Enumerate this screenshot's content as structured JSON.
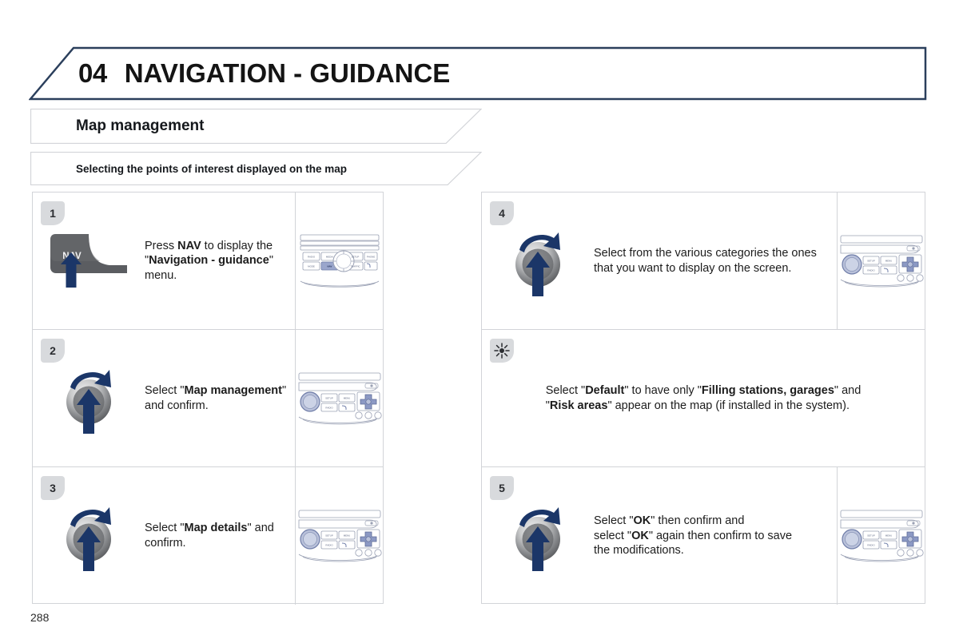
{
  "page": {
    "number": "288",
    "accent_color": "#2b3f5c",
    "badge_color": "#d8dadd",
    "border_color": "#d2d4d8",
    "arrow_color": "#1b3668"
  },
  "header": {
    "chapter_number": "04",
    "chapter_title": "NAVIGATION - GUIDANCE"
  },
  "sections": {
    "main_title": "Map management",
    "sub_title": "Selecting the points of interest displayed on the map"
  },
  "left_column": {
    "steps": [
      {
        "badge": "1",
        "control_icon": "nav-button-icon",
        "control_label": "NAV",
        "text_parts": [
          {
            "t": "Press ",
            "b": false
          },
          {
            "t": "NAV",
            "b": true
          },
          {
            "t": " to display the\n\"",
            "b": false
          },
          {
            "t": "Navigation - guidance",
            "b": true
          },
          {
            "t": "\" menu.",
            "b": false
          }
        ],
        "visual_icon": "radio-unit-knob-icon"
      },
      {
        "badge": "2",
        "control_icon": "rotary-knob-icon",
        "control_label": "",
        "text_parts": [
          {
            "t": "Select \"",
            "b": false
          },
          {
            "t": "Map management",
            "b": true
          },
          {
            "t": "\" and confirm.",
            "b": false
          }
        ],
        "visual_icon": "radio-unit-dpad-icon"
      },
      {
        "badge": "3",
        "control_icon": "rotary-knob-icon",
        "control_label": "",
        "text_parts": [
          {
            "t": "Select \"",
            "b": false
          },
          {
            "t": "Map details",
            "b": true
          },
          {
            "t": "\" and confirm.",
            "b": false
          }
        ],
        "visual_icon": "radio-unit-dpad-icon"
      }
    ]
  },
  "right_column": {
    "steps": [
      {
        "badge": "4",
        "control_icon": "rotary-knob-icon",
        "control_label": "",
        "text_parts": [
          {
            "t": "Select from the various categories the ones that you want to display on the screen.",
            "b": false
          }
        ],
        "visual_icon": "radio-unit-dpad-icon"
      },
      {
        "badge": "tip",
        "badge_icon": "sun-tip-icon",
        "control_icon": "",
        "control_label": "",
        "is_tip": true,
        "text_parts": [
          {
            "t": "Select \"",
            "b": false
          },
          {
            "t": "Default",
            "b": true
          },
          {
            "t": "\" to have only \"",
            "b": false
          },
          {
            "t": "Filling stations, garages",
            "b": true
          },
          {
            "t": "\" and\n\"",
            "b": false
          },
          {
            "t": "Risk areas",
            "b": true
          },
          {
            "t": "\" appear on the map (if installed in the system).",
            "b": false
          }
        ],
        "visual_icon": ""
      },
      {
        "badge": "5",
        "control_icon": "rotary-knob-icon",
        "control_label": "",
        "text_parts": [
          {
            "t": "Select \"",
            "b": false
          },
          {
            "t": "OK",
            "b": true
          },
          {
            "t": "\" then confirm and\nselect \"",
            "b": false
          },
          {
            "t": "OK",
            "b": true
          },
          {
            "t": "\" again then confirm to save\nthe modifications.",
            "b": false
          }
        ],
        "visual_icon": "radio-unit-dpad-icon"
      }
    ]
  },
  "radio_unit_a": {
    "name": "radio-unit-knob-icon",
    "buttons": [
      "RADIO",
      "MEDIA",
      "SETUP",
      "PHONE",
      "MODE",
      "NAV",
      "TRAFFIC"
    ],
    "highlighted_button": "NAV"
  },
  "radio_unit_b": {
    "name": "radio-unit-dpad-icon",
    "buttons": [
      "SETUP",
      "MENU",
      "RADIO"
    ],
    "highlighted_button": ""
  }
}
